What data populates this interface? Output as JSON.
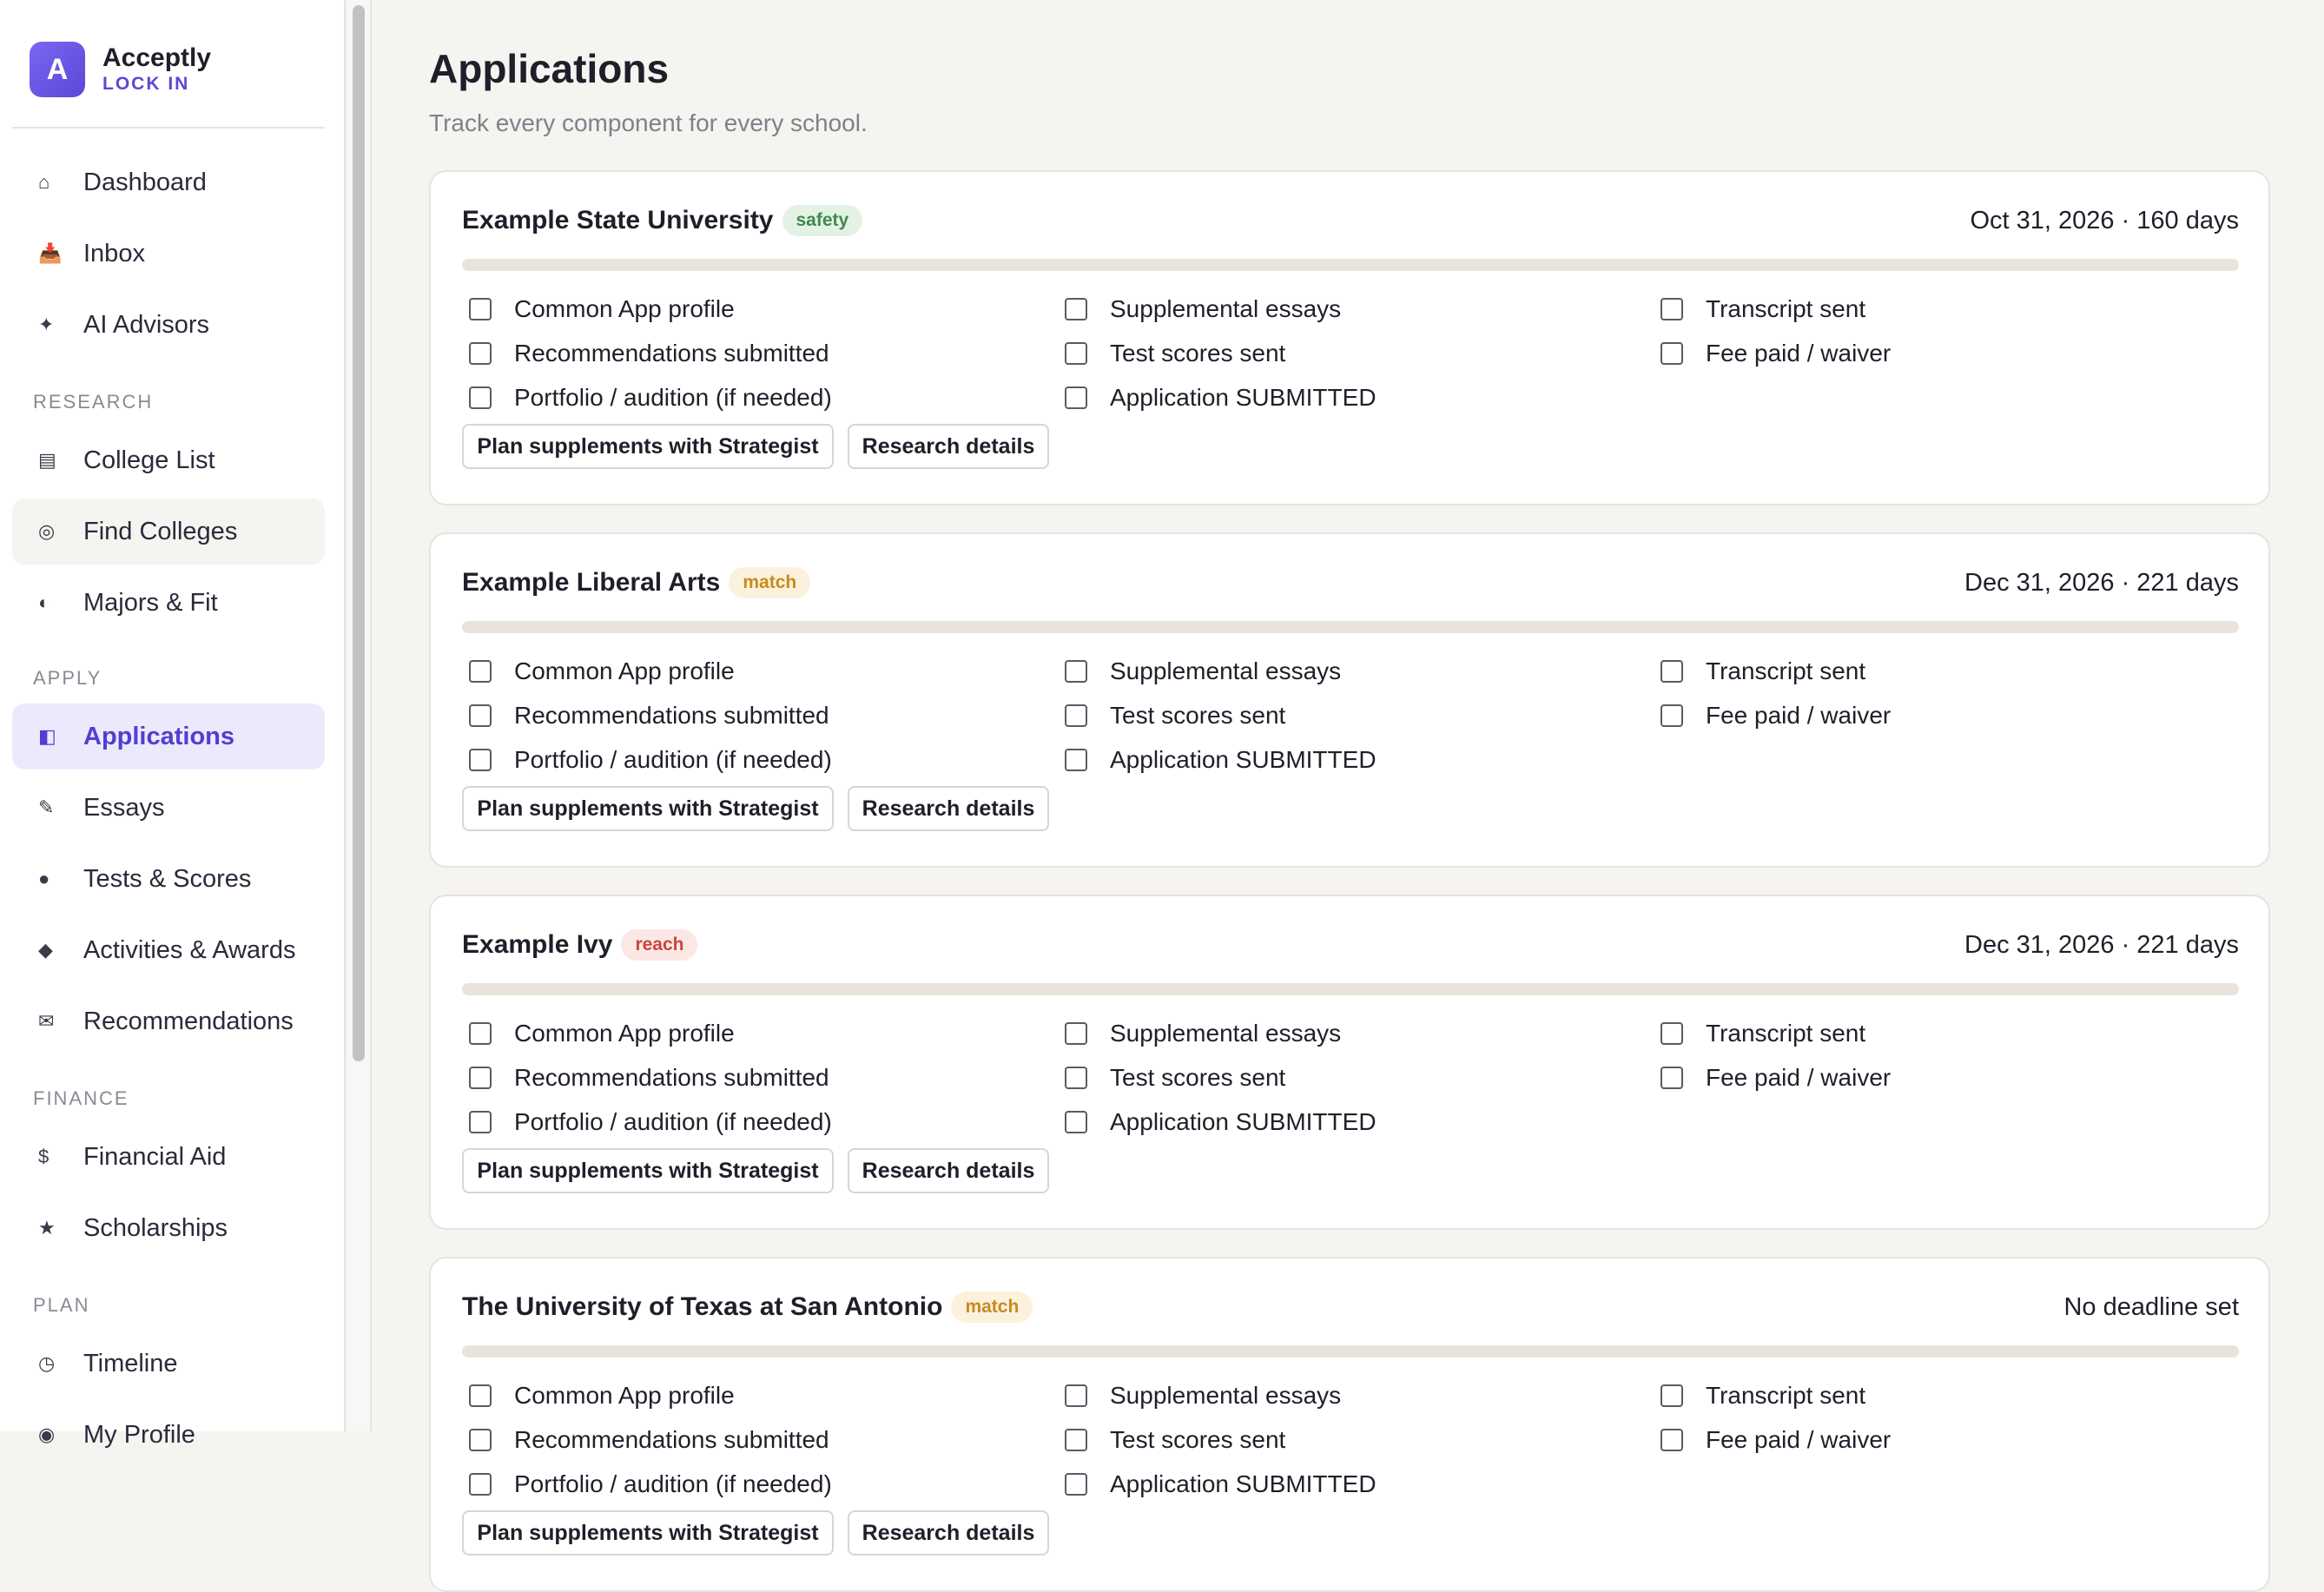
{
  "brand": {
    "logo_letter": "A",
    "name": "Acceptly",
    "tagline": "LOCK IN"
  },
  "sidebar": {
    "items": [
      {
        "label": "Dashboard",
        "icon": "home-icon",
        "glyph": "⌂"
      },
      {
        "label": "Inbox",
        "icon": "inbox-icon",
        "glyph": "📥"
      },
      {
        "label": "AI Advisors",
        "icon": "sparkle-icon",
        "glyph": "✦"
      }
    ],
    "sections": [
      {
        "title": "RESEARCH",
        "items": [
          {
            "label": "College List",
            "icon": "list-icon",
            "glyph": "▤"
          },
          {
            "label": "Find Colleges",
            "icon": "target-icon",
            "glyph": "◎"
          },
          {
            "label": "Majors & Fit",
            "icon": "half-circle-icon",
            "glyph": "◐"
          }
        ]
      },
      {
        "title": "APPLY",
        "items": [
          {
            "label": "Applications",
            "icon": "applications-icon",
            "glyph": "◧"
          },
          {
            "label": "Essays",
            "icon": "pencil-icon",
            "glyph": "✎"
          },
          {
            "label": "Tests & Scores",
            "icon": "dot-icon",
            "glyph": "●"
          },
          {
            "label": "Activities & Awards",
            "icon": "diamond-icon",
            "glyph": "◆"
          },
          {
            "label": "Recommendations",
            "icon": "envelope-icon",
            "glyph": "✉"
          }
        ]
      },
      {
        "title": "FINANCE",
        "items": [
          {
            "label": "Financial Aid",
            "icon": "dollar-icon",
            "glyph": "$"
          },
          {
            "label": "Scholarships",
            "icon": "star-icon",
            "glyph": "★"
          }
        ]
      },
      {
        "title": "PLAN",
        "items": [
          {
            "label": "Timeline",
            "icon": "clock-icon",
            "glyph": "◷"
          },
          {
            "label": "My Profile",
            "icon": "profile-icon",
            "glyph": "◉"
          }
        ]
      }
    ],
    "active_item": "Applications",
    "hover_item": "Find Colleges"
  },
  "main": {
    "title": "Applications",
    "subtitle": "Track every component for every school.",
    "buttons": {
      "strategist": "Plan supplements with Strategist",
      "research": "Research details"
    },
    "checklist": {
      "col1": [
        "Common App profile",
        "Recommendations submitted",
        "Portfolio / audition (if needed)"
      ],
      "col2": [
        "Supplemental essays",
        "Test scores sent",
        "Application SUBMITTED"
      ],
      "col3": [
        "Transcript sent",
        "Fee paid / waiver"
      ]
    },
    "schools": [
      {
        "name": "Example State University",
        "tier": "safety",
        "deadline": "Oct 31, 2026 · 160 days",
        "progress": 0
      },
      {
        "name": "Example Liberal Arts",
        "tier": "match",
        "deadline": "Dec 31, 2026 · 221 days",
        "progress": 0
      },
      {
        "name": "Example Ivy",
        "tier": "reach",
        "deadline": "Dec 31, 2026 · 221 days",
        "progress": 0
      },
      {
        "name": "The University of Texas at San Antonio",
        "tier": "match",
        "deadline": "No deadline set",
        "progress": 0
      }
    ]
  },
  "colors": {
    "accent": "#5b48d9",
    "active_bg": "#ece9fc",
    "page_bg": "#f5f4f1",
    "progress_track": "#e8e4db"
  }
}
